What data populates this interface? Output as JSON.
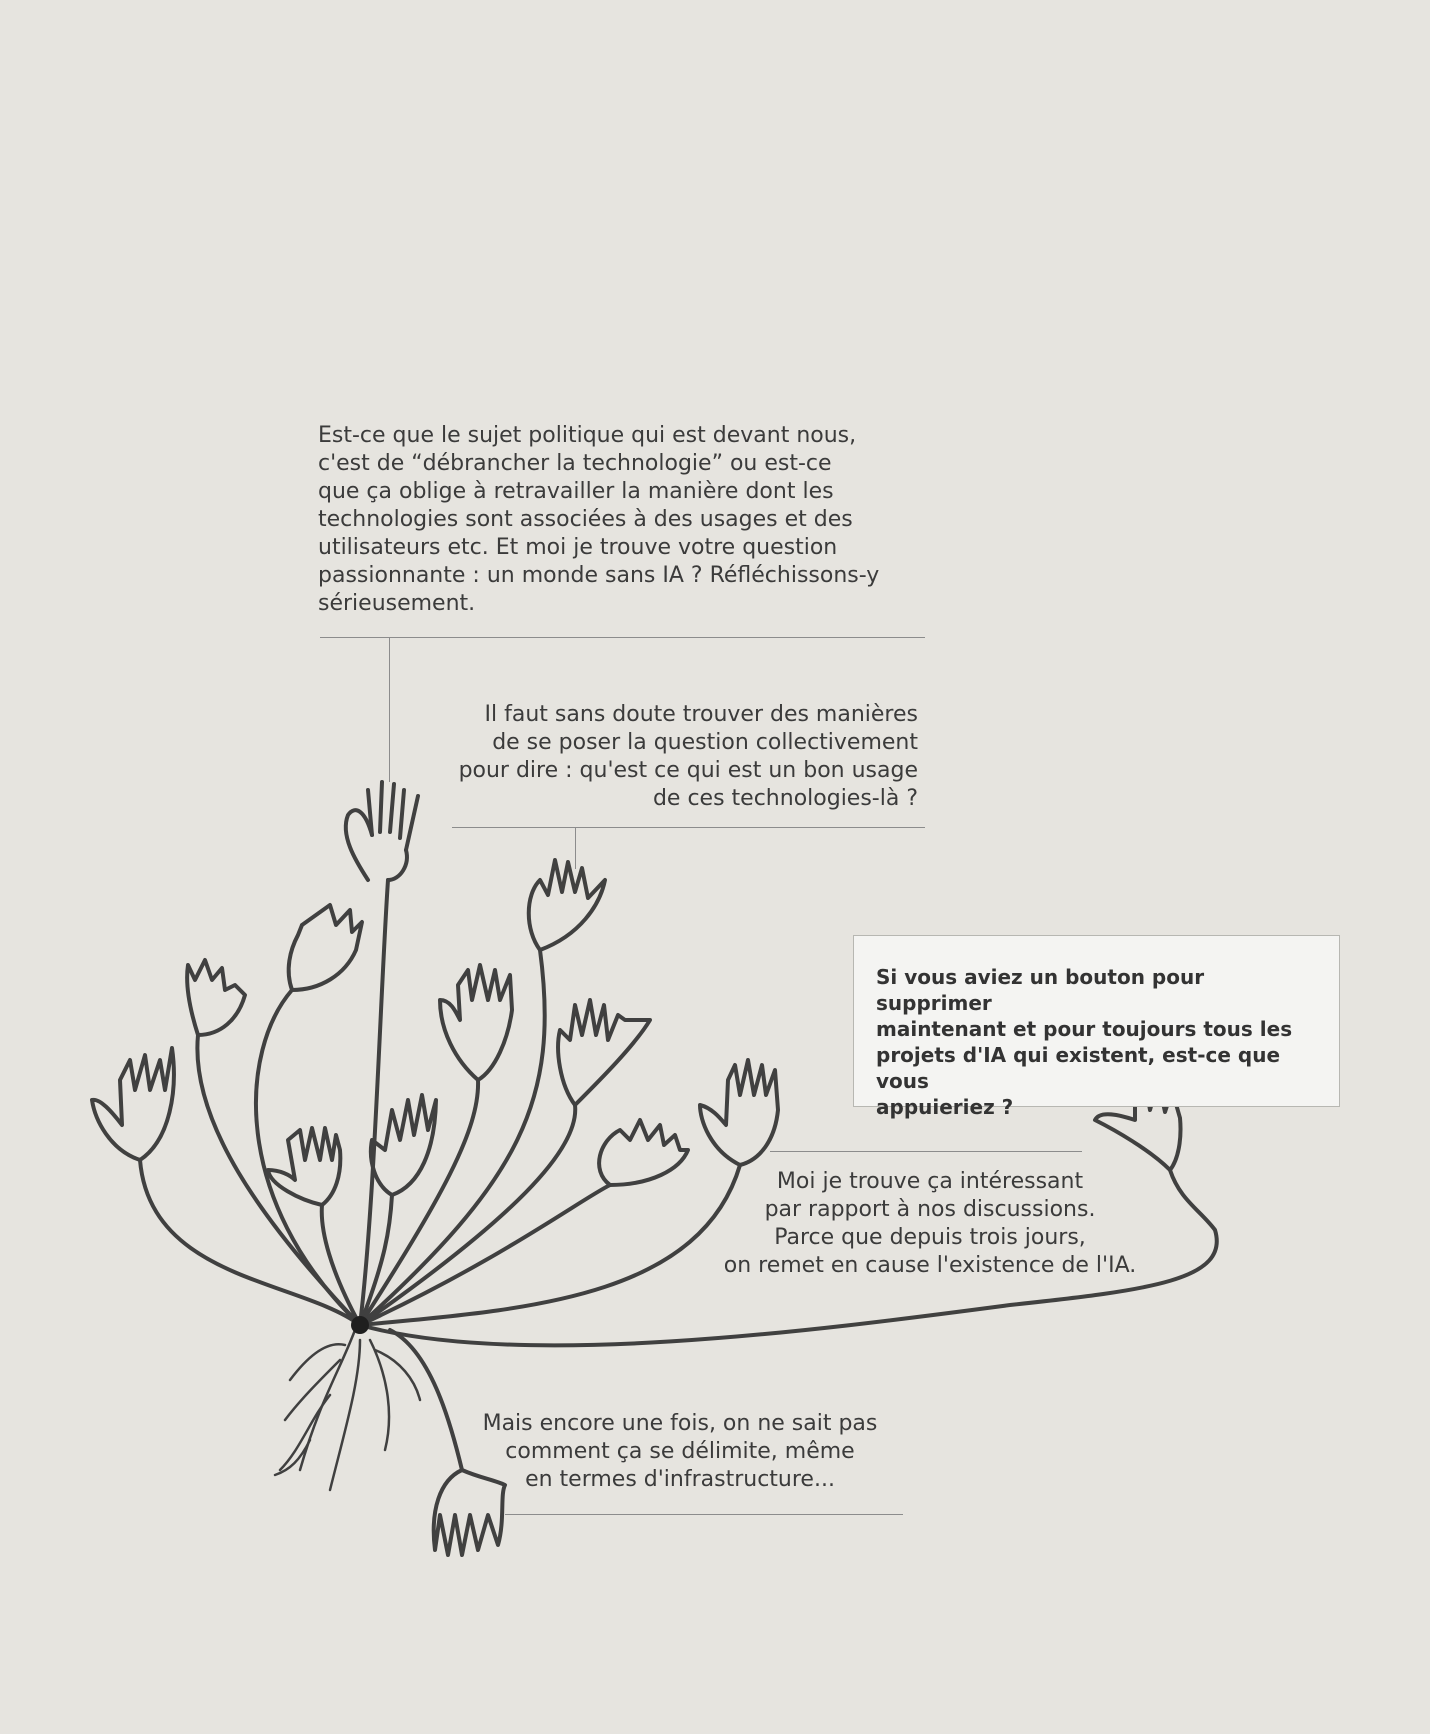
{
  "quotes": {
    "q1": "Est-ce que le sujet politique qui est devant nous,\nc'est de “débrancher la technologie” ou est-ce\nque ça oblige à retravailler la manière dont les\ntechnologies sont associées à des usages et des\nutilisateurs etc. Et moi je trouve votre question\npassionnante : un monde sans IA ? Réfléchissons-y\nsérieusement.",
    "q2": "Il faut sans doute trouver des manières\nde se poser la question collectivement\npour dire : qu'est ce qui est un bon usage\nde ces technologies-là ?",
    "q3": "Moi je trouve ça intéressant\npar rapport à nos discussions.\nParce que depuis trois jours,\non remet en cause l'existence de l'IA.",
    "q4": "Mais encore une fois, on ne sait pas\ncomment ça se délimite, même\nen termes d'infrastructure..."
  },
  "question_box": {
    "text": "Si vous aviez un bouton pour supprimer\nmaintenant et pour toujours tous les\nprojets d'IA qui existent, est-ce que vous\nappuieriez ?"
  },
  "colors": {
    "background": "#e6e4df",
    "ink": "#2e2e2e",
    "rule": "#8c8c8c"
  }
}
